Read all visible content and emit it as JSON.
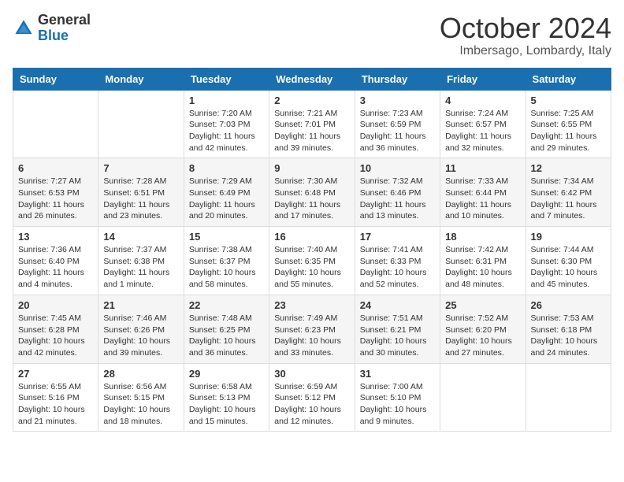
{
  "logo": {
    "general": "General",
    "blue": "Blue"
  },
  "header": {
    "month": "October 2024",
    "location": "Imbersago, Lombardy, Italy"
  },
  "weekdays": [
    "Sunday",
    "Monday",
    "Tuesday",
    "Wednesday",
    "Thursday",
    "Friday",
    "Saturday"
  ],
  "weeks": [
    [
      {
        "day": "",
        "info": ""
      },
      {
        "day": "",
        "info": ""
      },
      {
        "day": "1",
        "info": "Sunrise: 7:20 AM\nSunset: 7:03 PM\nDaylight: 11 hours and 42 minutes."
      },
      {
        "day": "2",
        "info": "Sunrise: 7:21 AM\nSunset: 7:01 PM\nDaylight: 11 hours and 39 minutes."
      },
      {
        "day": "3",
        "info": "Sunrise: 7:23 AM\nSunset: 6:59 PM\nDaylight: 11 hours and 36 minutes."
      },
      {
        "day": "4",
        "info": "Sunrise: 7:24 AM\nSunset: 6:57 PM\nDaylight: 11 hours and 32 minutes."
      },
      {
        "day": "5",
        "info": "Sunrise: 7:25 AM\nSunset: 6:55 PM\nDaylight: 11 hours and 29 minutes."
      }
    ],
    [
      {
        "day": "6",
        "info": "Sunrise: 7:27 AM\nSunset: 6:53 PM\nDaylight: 11 hours and 26 minutes."
      },
      {
        "day": "7",
        "info": "Sunrise: 7:28 AM\nSunset: 6:51 PM\nDaylight: 11 hours and 23 minutes."
      },
      {
        "day": "8",
        "info": "Sunrise: 7:29 AM\nSunset: 6:49 PM\nDaylight: 11 hours and 20 minutes."
      },
      {
        "day": "9",
        "info": "Sunrise: 7:30 AM\nSunset: 6:48 PM\nDaylight: 11 hours and 17 minutes."
      },
      {
        "day": "10",
        "info": "Sunrise: 7:32 AM\nSunset: 6:46 PM\nDaylight: 11 hours and 13 minutes."
      },
      {
        "day": "11",
        "info": "Sunrise: 7:33 AM\nSunset: 6:44 PM\nDaylight: 11 hours and 10 minutes."
      },
      {
        "day": "12",
        "info": "Sunrise: 7:34 AM\nSunset: 6:42 PM\nDaylight: 11 hours and 7 minutes."
      }
    ],
    [
      {
        "day": "13",
        "info": "Sunrise: 7:36 AM\nSunset: 6:40 PM\nDaylight: 11 hours and 4 minutes."
      },
      {
        "day": "14",
        "info": "Sunrise: 7:37 AM\nSunset: 6:38 PM\nDaylight: 11 hours and 1 minute."
      },
      {
        "day": "15",
        "info": "Sunrise: 7:38 AM\nSunset: 6:37 PM\nDaylight: 10 hours and 58 minutes."
      },
      {
        "day": "16",
        "info": "Sunrise: 7:40 AM\nSunset: 6:35 PM\nDaylight: 10 hours and 55 minutes."
      },
      {
        "day": "17",
        "info": "Sunrise: 7:41 AM\nSunset: 6:33 PM\nDaylight: 10 hours and 52 minutes."
      },
      {
        "day": "18",
        "info": "Sunrise: 7:42 AM\nSunset: 6:31 PM\nDaylight: 10 hours and 48 minutes."
      },
      {
        "day": "19",
        "info": "Sunrise: 7:44 AM\nSunset: 6:30 PM\nDaylight: 10 hours and 45 minutes."
      }
    ],
    [
      {
        "day": "20",
        "info": "Sunrise: 7:45 AM\nSunset: 6:28 PM\nDaylight: 10 hours and 42 minutes."
      },
      {
        "day": "21",
        "info": "Sunrise: 7:46 AM\nSunset: 6:26 PM\nDaylight: 10 hours and 39 minutes."
      },
      {
        "day": "22",
        "info": "Sunrise: 7:48 AM\nSunset: 6:25 PM\nDaylight: 10 hours and 36 minutes."
      },
      {
        "day": "23",
        "info": "Sunrise: 7:49 AM\nSunset: 6:23 PM\nDaylight: 10 hours and 33 minutes."
      },
      {
        "day": "24",
        "info": "Sunrise: 7:51 AM\nSunset: 6:21 PM\nDaylight: 10 hours and 30 minutes."
      },
      {
        "day": "25",
        "info": "Sunrise: 7:52 AM\nSunset: 6:20 PM\nDaylight: 10 hours and 27 minutes."
      },
      {
        "day": "26",
        "info": "Sunrise: 7:53 AM\nSunset: 6:18 PM\nDaylight: 10 hours and 24 minutes."
      }
    ],
    [
      {
        "day": "27",
        "info": "Sunrise: 6:55 AM\nSunset: 5:16 PM\nDaylight: 10 hours and 21 minutes."
      },
      {
        "day": "28",
        "info": "Sunrise: 6:56 AM\nSunset: 5:15 PM\nDaylight: 10 hours and 18 minutes."
      },
      {
        "day": "29",
        "info": "Sunrise: 6:58 AM\nSunset: 5:13 PM\nDaylight: 10 hours and 15 minutes."
      },
      {
        "day": "30",
        "info": "Sunrise: 6:59 AM\nSunset: 5:12 PM\nDaylight: 10 hours and 12 minutes."
      },
      {
        "day": "31",
        "info": "Sunrise: 7:00 AM\nSunset: 5:10 PM\nDaylight: 10 hours and 9 minutes."
      },
      {
        "day": "",
        "info": ""
      },
      {
        "day": "",
        "info": ""
      }
    ]
  ]
}
